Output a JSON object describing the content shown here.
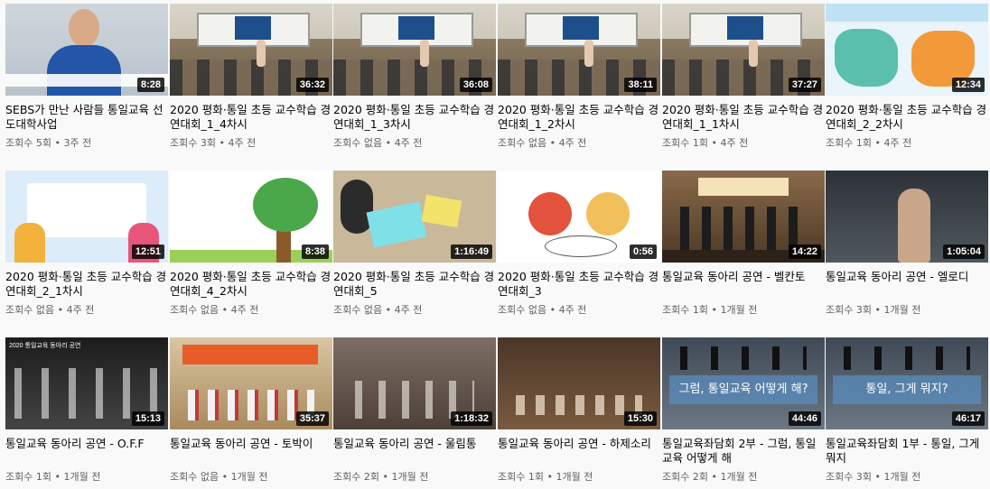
{
  "videos": [
    {
      "title": "SEBS가 만난 사람들 통일교육 선도대학사업",
      "duration": "8:28",
      "meta": "조회수 5회 • 3주 전"
    },
    {
      "title": "2020 평화·통일 초등 교수학습 경연대회_1_4차시",
      "duration": "36:32",
      "meta": "조회수 3회 • 4주 전"
    },
    {
      "title": "2020 평화·통일 초등 교수학습 경연대회_1_3차시",
      "duration": "36:08",
      "meta": "조회수 없음 • 4주 전"
    },
    {
      "title": "2020 평화·통일 초등 교수학습 경연대회_1_2차시",
      "duration": "38:11",
      "meta": "조회수 없음 • 4주 전"
    },
    {
      "title": "2020 평화·통일 초등 교수학습 경연대회_1_1차시",
      "duration": "37:27",
      "meta": "조회수 1회 • 4주 전"
    },
    {
      "title": "2020 평화·통일 초등 교수학습 경연대회_2_2차시",
      "duration": "12:34",
      "meta": "조회수 1회 • 4주 전"
    },
    {
      "title": "2020 평화·통일 초등 교수학습 경연대회_2_1차시",
      "duration": "12:51",
      "meta": "조회수 없음 • 4주 전"
    },
    {
      "title": "2020 평화·통일 초등 교수학습 경연대회_4_2차시",
      "duration": "8:38",
      "meta": "조회수 없음 • 4주 전"
    },
    {
      "title": "2020 평화·통일 초등 교수학습 경연대회_5",
      "duration": "1:16:49",
      "meta": "조회수 없음 • 4주 전"
    },
    {
      "title": "2020 평화·통일 초등 교수학습 경연대회_3",
      "duration": "0:56",
      "meta": "조회수 없음 • 4주 전"
    },
    {
      "title": "통일교육 동아리 공연 - 벨칸토",
      "duration": "14:22",
      "meta": "조회수 1회 • 1개월 전"
    },
    {
      "title": "통일교육 동아리 공연 - 엘로디",
      "duration": "1:05:04",
      "meta": "조회수 3회 • 1개월 전"
    },
    {
      "title": "통일교육 동아리 공연 - O.F.F",
      "duration": "15:13",
      "meta": "조회수 1회 • 1개월 전"
    },
    {
      "title": "통일교육 동아리 공연 - 토박이",
      "duration": "35:37",
      "meta": "조회수 없음 • 1개월 전"
    },
    {
      "title": "통일교육 동아리 공연 - 울림통",
      "duration": "1:18:32",
      "meta": "조회수 2회 • 1개월 전"
    },
    {
      "title": "통일교육 동아리 공연 - 하제소리",
      "duration": "15:30",
      "meta": "조회수 1회 • 1개월 전"
    },
    {
      "title": "통일교육좌담회 2부 - 그럼, 통일교육 어떻게 해",
      "duration": "44:46",
      "meta": "조회수 2회 • 1개월 전"
    },
    {
      "title": "통일교육좌담회 1부 - 통일, 그게 뭐지",
      "duration": "46:17",
      "meta": "조회수 3회 • 1개월 전"
    }
  ],
  "thumb_text": {
    "talk1": "그럼, 통일교육 어떻게 해?",
    "talk2": "통일, 그게 뭐지?",
    "band_caption": "2020 통일교육 동아리 공연"
  }
}
